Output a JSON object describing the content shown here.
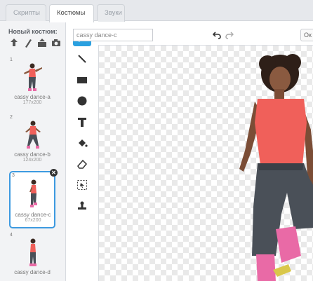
{
  "tabs": [
    {
      "label": "Скрипты"
    },
    {
      "label": "Костюмы"
    },
    {
      "label": "Звуки"
    }
  ],
  "new_costume": {
    "label": "Новый костюм:"
  },
  "costumes": [
    {
      "number": "1",
      "name": "cassy dance-a",
      "size": "177x200"
    },
    {
      "number": "2",
      "name": "cassy dance-b",
      "size": "124x200"
    },
    {
      "number": "3",
      "name": "cassy dance-c",
      "size": "67x200"
    },
    {
      "number": "4",
      "name": "cassy dance-d",
      "size": ""
    }
  ],
  "editor": {
    "costume_name": "cassy dance-c",
    "ok_label": "Ок"
  },
  "colors": {
    "accent": "#2aa0e0",
    "selected_border": "#3d9ae0",
    "shirt": "#f0605a",
    "jeans": "#4a5058",
    "shoes": "#e96aa6"
  }
}
